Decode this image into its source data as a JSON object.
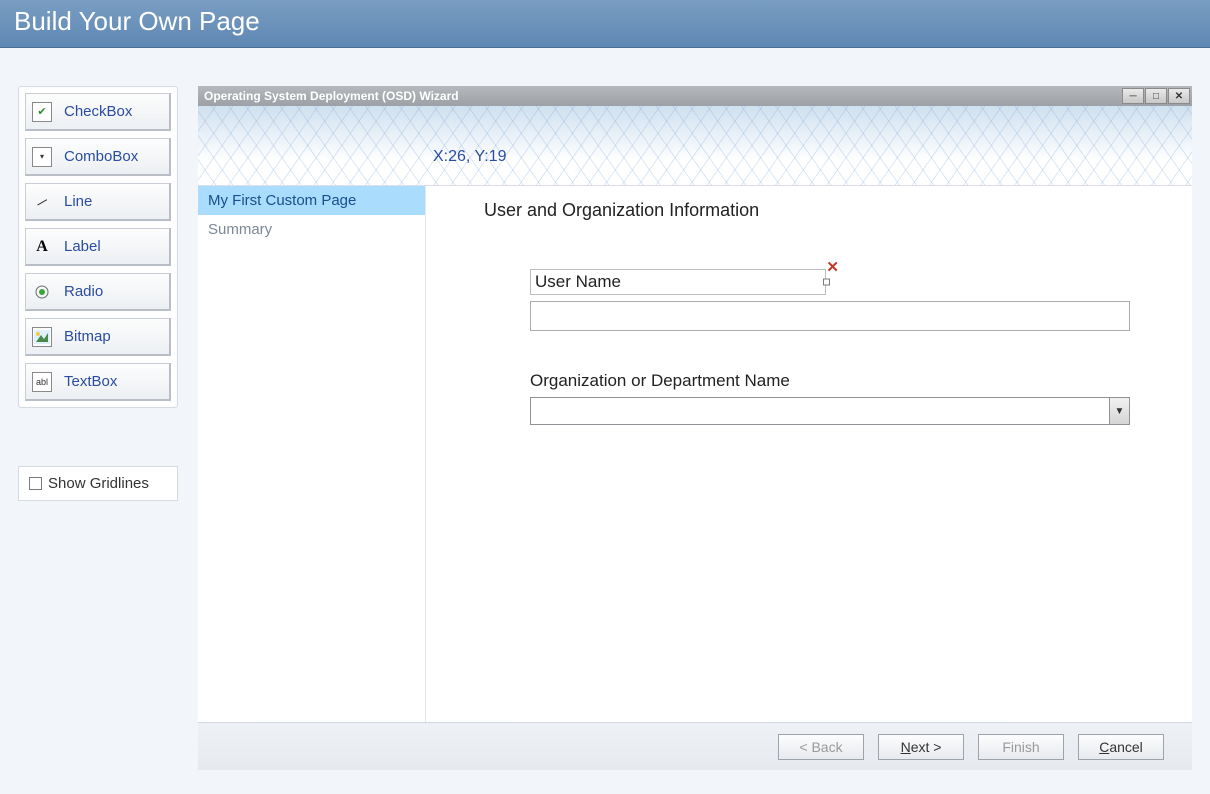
{
  "header": {
    "title": "Build Your Own Page"
  },
  "toolbox": {
    "items": [
      {
        "label": "CheckBox",
        "icon": "checkbox-icon"
      },
      {
        "label": "ComboBox",
        "icon": "combobox-icon"
      },
      {
        "label": "Line",
        "icon": "line-icon"
      },
      {
        "label": "Label",
        "icon": "label-icon"
      },
      {
        "label": "Radio",
        "icon": "radio-icon"
      },
      {
        "label": "Bitmap",
        "icon": "bitmap-icon"
      },
      {
        "label": "TextBox",
        "icon": "textbox-icon"
      }
    ]
  },
  "show_gridlines": {
    "label": "Show Gridlines",
    "checked": false
  },
  "wizard": {
    "title": "Operating System Deployment (OSD) Wizard",
    "coords": "X:26, Y:19",
    "nav": [
      {
        "label": "My First Custom Page",
        "active": true
      },
      {
        "label": "Summary",
        "active": false
      }
    ],
    "content": {
      "heading": "User and Organization Information",
      "fields": {
        "user_name_label": "User Name",
        "user_name_value": "",
        "org_label": "Organization or Department Name",
        "org_value": ""
      }
    },
    "buttons": {
      "back": "< Back",
      "next": "Next >",
      "finish": "Finish",
      "cancel": "Cancel"
    }
  }
}
